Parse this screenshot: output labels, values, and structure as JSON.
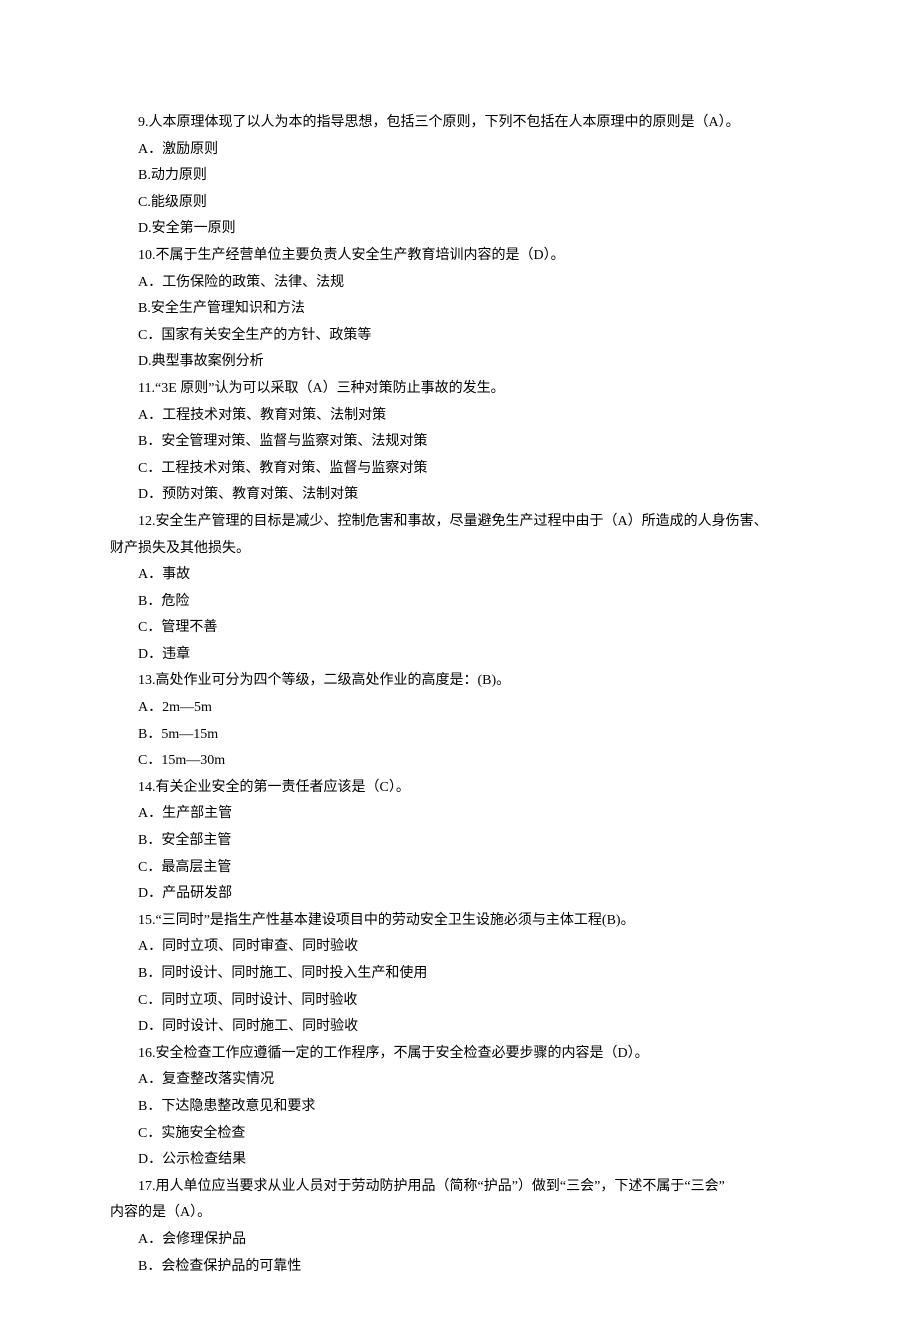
{
  "questions": [
    {
      "stem": "9.人本原理体现了以人为本的指导思想，包括三个原则，下列不包括在人本原理中的原则是（A）。",
      "options": [
        "A．激励原则",
        "B.动力原则",
        "C.能级原则",
        "D.安全第一原则"
      ]
    },
    {
      "stem": "10.不属于生产经营单位主要负责人安全生产教育培训内容的是（D）。",
      "options": [
        "A．工伤保险的政策、法律、法规",
        "B.安全生产管理知识和方法",
        "C．国家有关安全生产的方针、政策等",
        "D.典型事故案例分析"
      ]
    },
    {
      "stem": "11.“3E 原则”认为可以采取（A）三种对策防止事故的发生。",
      "options": [
        "A．工程技术对策、教育对策、法制对策",
        "B．安全管理对策、监督与监察对策、法规对策",
        "C．工程技术对策、教育对策、监督与监察对策",
        "D．预防对策、教育对策、法制对策"
      ]
    },
    {
      "stem": "12.安全生产管理的目标是减少、控制危害和事故，尽量避免生产过程中由于（A）所造成的人身伤害、",
      "cont": "财产损失及其他损失。",
      "options": [
        "A．事故",
        "B．危险",
        "C．管理不善",
        "D．违章"
      ]
    },
    {
      "stem": "13.高处作业可分为四个等级，二级高处作业的高度是：(B)。",
      "options": [
        "A．2m—5m",
        "B．5m—15m",
        "C．15m—30m"
      ]
    },
    {
      "stem": "14.有关企业安全的第一责任者应该是（C）。",
      "options": [
        "A．生产部主管",
        "B．安全部主管",
        "C．最高层主管",
        "D．产品研发部"
      ]
    },
    {
      "stem": "15.“三同时”是指生产性基本建设项目中的劳动安全卫生设施必须与主体工程(B)。",
      "options": [
        "A．同时立项、同时审查、同时验收",
        "B．同时设计、同时施工、同时投入生产和使用",
        "C．同时立项、同时设计、同时验收",
        "D．同时设计、同时施工、同时验收"
      ]
    },
    {
      "stem": "16.安全检查工作应遵循一定的工作程序，不属于安全检查必要步骤的内容是（D）。",
      "options": [
        "A．复查整改落实情况",
        "B．下达隐患整改意见和要求",
        "C．实施安全检查",
        "D．公示检查结果"
      ]
    },
    {
      "stem": "17.用人单位应当要求从业人员对于劳动防护用品（简称“护品”）做到“三会”，下述不属于“三会”",
      "cont": "内容的是（A）。",
      "options": [
        "A．会修理保护品",
        "B．会检查保护品的可靠性"
      ]
    }
  ]
}
